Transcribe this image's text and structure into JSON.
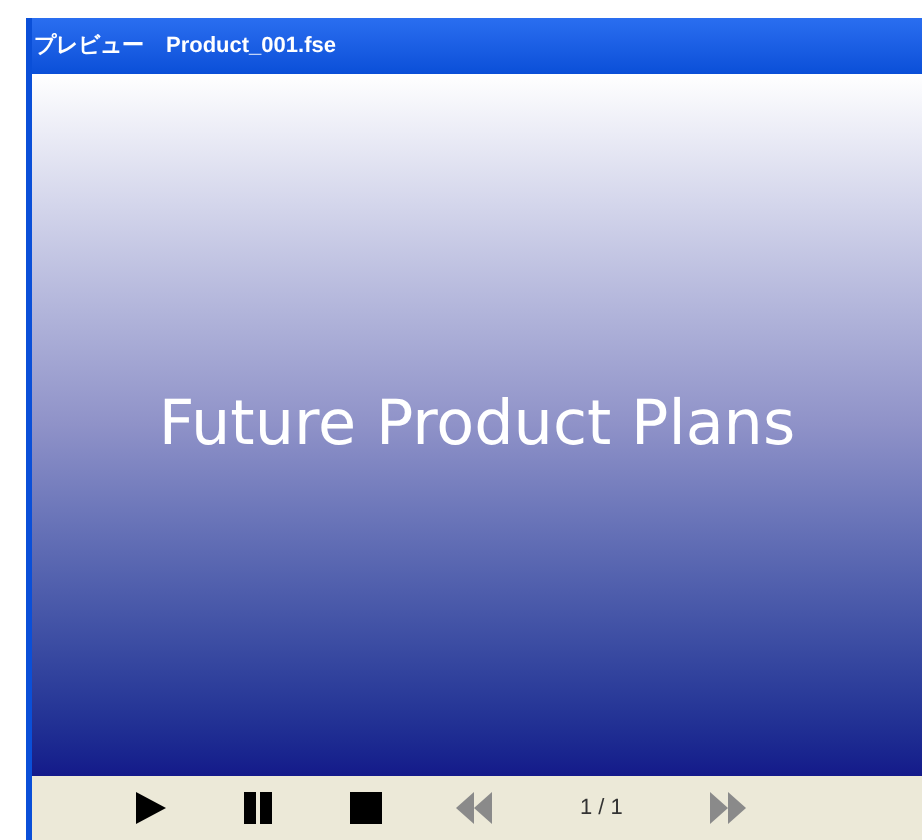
{
  "window": {
    "title": "プレビュー　Product_001.fse"
  },
  "slide": {
    "title": "Future Product Plans"
  },
  "controls": [
    {
      "kind": "play",
      "disabled": false
    },
    {
      "kind": "pause",
      "disabled": false
    },
    {
      "kind": "stop",
      "disabled": false
    },
    {
      "kind": "previous",
      "disabled": true
    }
  ],
  "page_indicator": "1 / 1",
  "next": {
    "kind": "next",
    "disabled": true
  }
}
